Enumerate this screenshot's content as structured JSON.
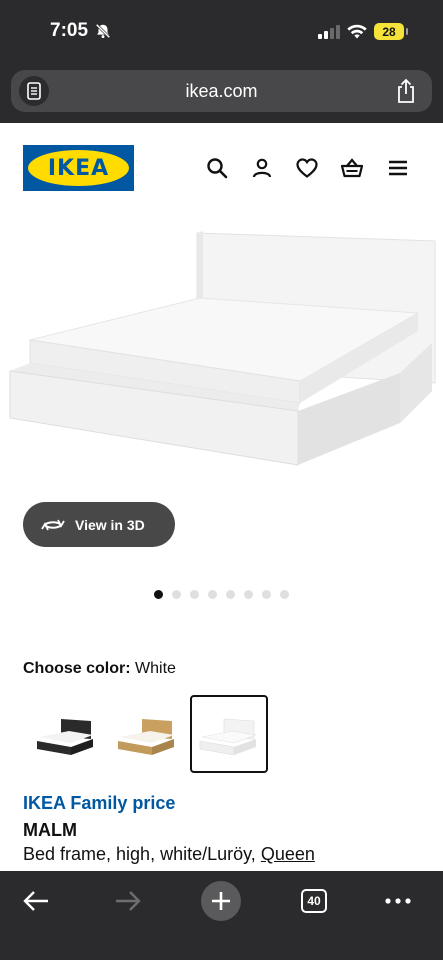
{
  "status_bar": {
    "time": "7:05",
    "battery": "28"
  },
  "browser": {
    "url": "ikea.com",
    "tab_count": "40"
  },
  "header": {
    "logo_text": "IKEA",
    "icons": [
      "search-icon",
      "account-icon",
      "heart-icon",
      "basket-icon",
      "menu-icon"
    ]
  },
  "gallery": {
    "view_3d_label": "View in 3D",
    "total_images": 8,
    "active_index": 0
  },
  "color_chooser": {
    "label": "Choose color:",
    "value": "White",
    "options": [
      "black-brown",
      "oak veneer",
      "white"
    ],
    "selected": "white"
  },
  "product": {
    "family_price_label": "IKEA Family price",
    "name": "MALM",
    "description": "Bed frame, high, white/Luröy,",
    "size_link": "Queen"
  },
  "colors": {
    "ikea_blue": "#0058a3",
    "ikea_yellow": "#ffdb00",
    "chrome_dark": "#2b2b2d"
  }
}
